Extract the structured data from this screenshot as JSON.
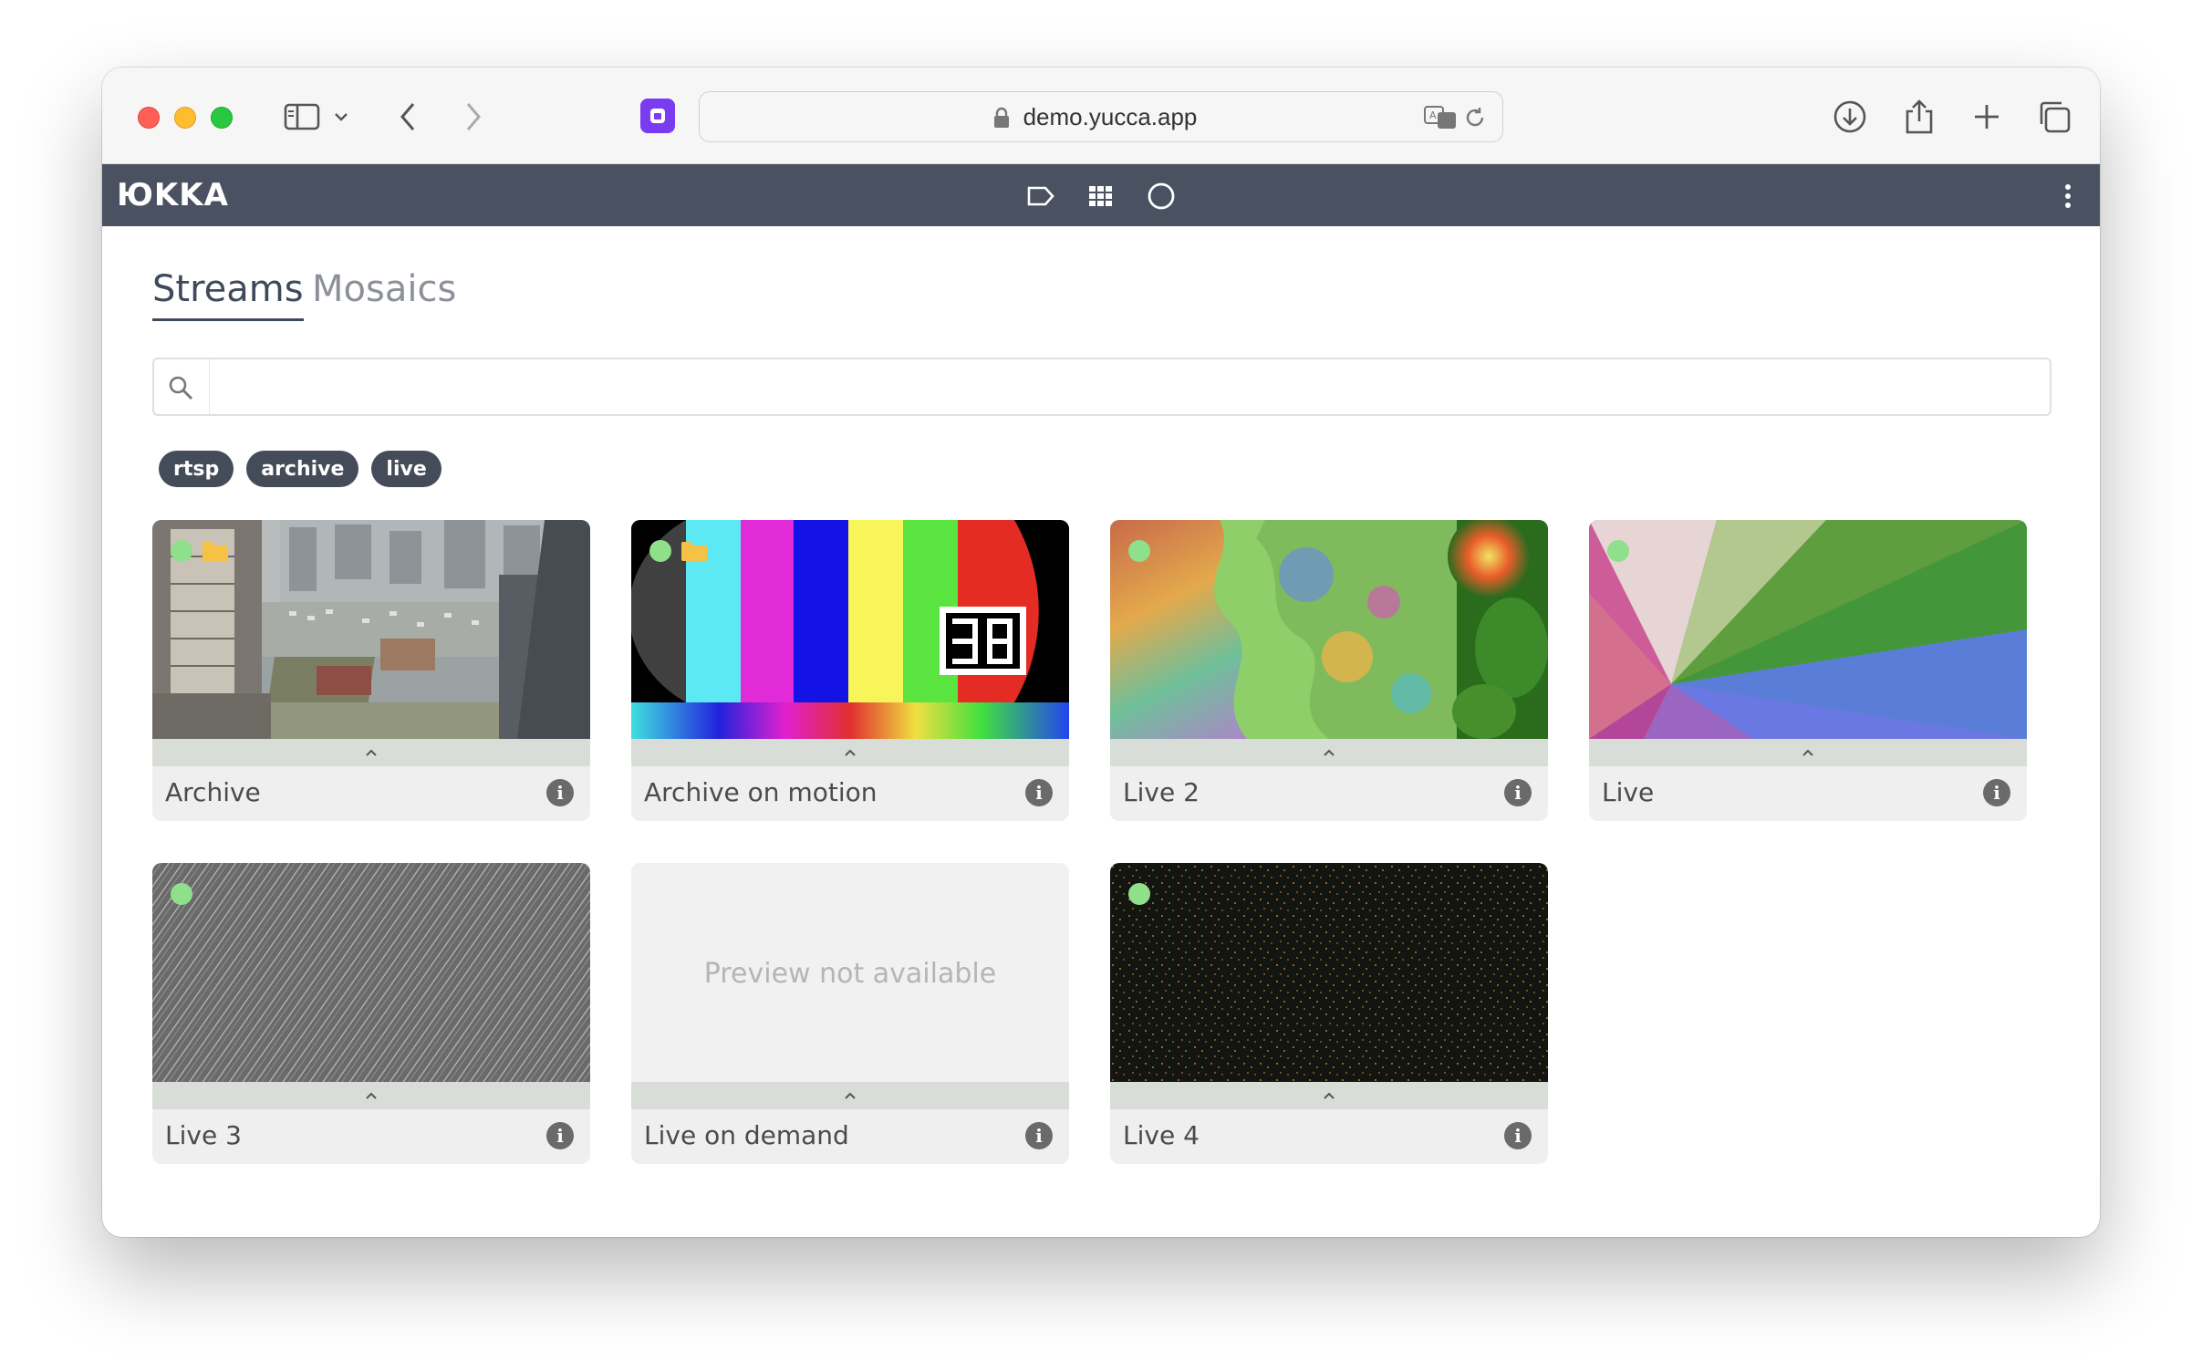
{
  "browser": {
    "url": "demo.yucca.app"
  },
  "app": {
    "logo": "ЮKKA"
  },
  "tabs": [
    "Streams",
    "Mosaics"
  ],
  "search": {
    "placeholder": "",
    "value": ""
  },
  "chips": [
    "rtsp",
    "archive",
    "live"
  ],
  "cards": [
    {
      "title": "Archive",
      "preview": "city-aerial",
      "status": "green",
      "archive_folder": true
    },
    {
      "title": "Archive on motion",
      "preview": "color-bars",
      "status": "green",
      "archive_folder": true
    },
    {
      "title": "Live 2",
      "preview": "fractal",
      "status": "green",
      "archive_folder": false
    },
    {
      "title": "Live",
      "preview": "gradient-cone",
      "status": "green",
      "archive_folder": false
    },
    {
      "title": "Live 3",
      "preview": "noise-gray",
      "status": "green",
      "archive_folder": false
    },
    {
      "title": "Live on demand",
      "preview": "none",
      "preview_text": "Preview not available",
      "archive_folder": false
    },
    {
      "title": "Live 4",
      "preview": "noise-dark",
      "status": "green",
      "archive_folder": false
    }
  ],
  "colors": {
    "appbar": "#4a5261",
    "chip": "#444c5a",
    "status_online": "#8fe08a",
    "archive_folder": "#f5c245"
  }
}
